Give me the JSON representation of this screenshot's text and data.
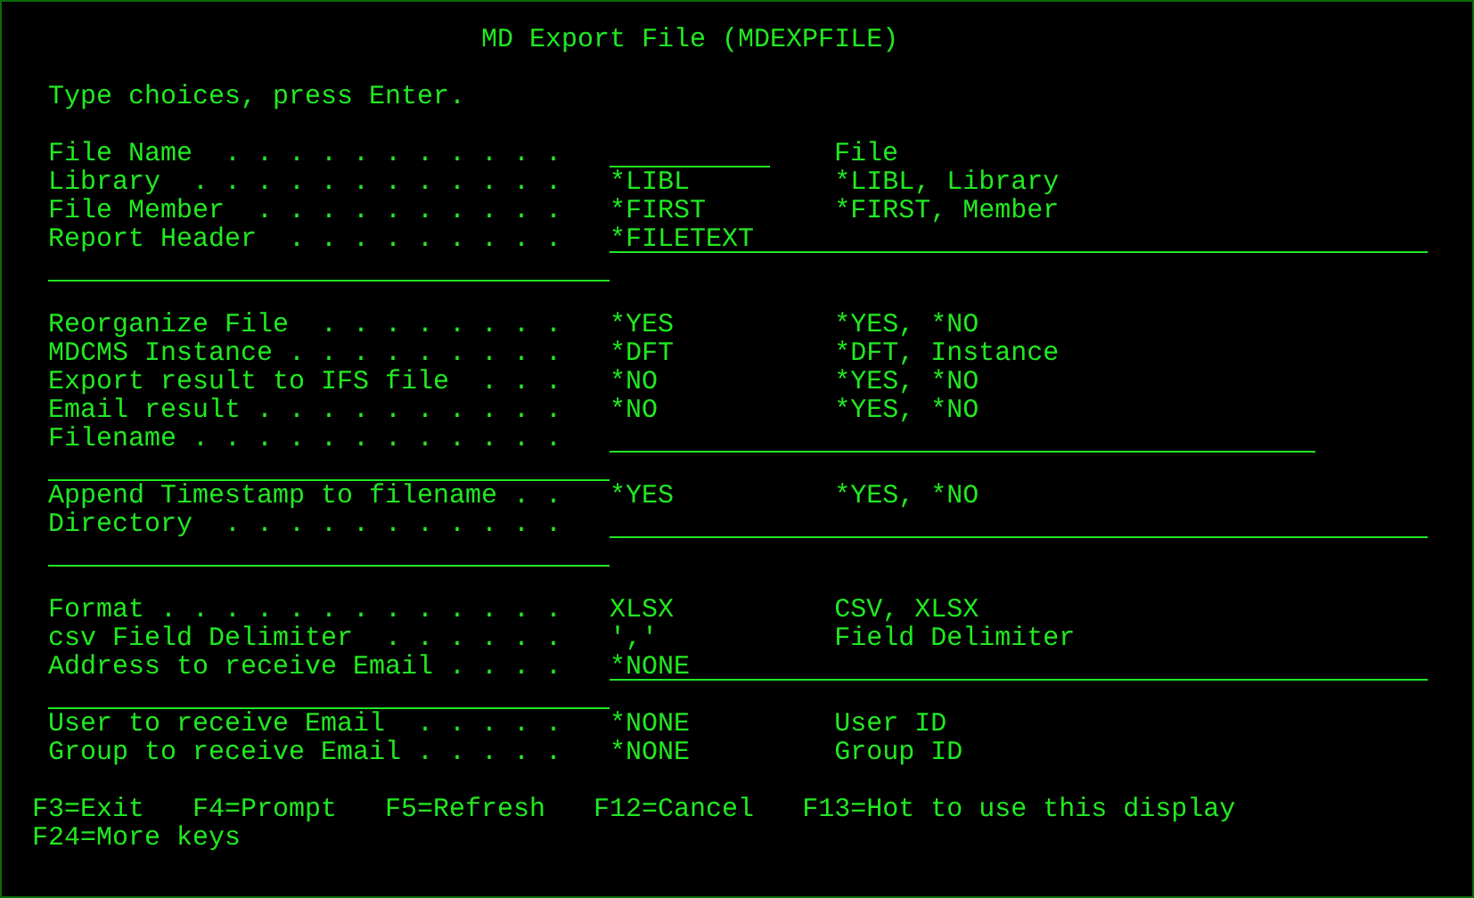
{
  "title": "MD Export File (MDEXPFILE)",
  "instruction": "Type choices, press Enter.",
  "sections": [
    {
      "rows": [
        {
          "label": "File Name  . . . . . . . . . . .",
          "kind": "name",
          "hint": "File",
          "wraps": false
        },
        {
          "label": "Library  . . . . . . . . . . . .",
          "kind": "choice",
          "value": "*LIBL",
          "hint": "*LIBL, Library",
          "wraps": false
        },
        {
          "label": "File Member  . . . . . . . . . .",
          "kind": "choice",
          "value": "*FIRST",
          "hint": "*FIRST, Member",
          "wraps": false
        },
        {
          "label": "Report Header  . . . . . . . . .",
          "kind": "long",
          "value": "*FILETEXT",
          "wraps": true
        }
      ]
    },
    {
      "rows": [
        {
          "label": "Reorganize File  . . . . . . . .",
          "kind": "choice",
          "value": "*YES",
          "hint": "*YES, *NO",
          "wraps": false
        },
        {
          "label": "MDCMS Instance . . . . . . . . .",
          "kind": "choice",
          "value": "*DFT",
          "hint": "*DFT, Instance",
          "wraps": false
        },
        {
          "label": "Export result to IFS file  . . .",
          "kind": "choice",
          "value": "*NO",
          "hint": "*YES, *NO",
          "wraps": false
        },
        {
          "label": "Email result . . . . . . . . . .",
          "kind": "choice",
          "value": "*NO",
          "hint": "*YES, *NO",
          "wraps": false
        },
        {
          "label": "Filename . . . . . . . . . . . .",
          "kind": "path",
          "wraps": true
        },
        {
          "label": "Append Timestamp to filename . .",
          "kind": "choice",
          "value": "*YES",
          "hint": "*YES, *NO",
          "wraps": false
        },
        {
          "label": "Directory  . . . . . . . . . . .",
          "kind": "long",
          "wraps": true
        }
      ]
    },
    {
      "rows": [
        {
          "label": "Format . . . . . . . . . . . . .",
          "kind": "choice",
          "value": "XLSX",
          "hint": "CSV, XLSX",
          "wraps": false
        },
        {
          "label": "csv Field Delimiter  . . . . . .",
          "kind": "choice",
          "value": "','",
          "hint": "Field Delimiter",
          "wraps": false
        },
        {
          "label": "Address to receive Email . . . .",
          "kind": "long",
          "value": "*NONE",
          "wraps": true
        },
        {
          "label": "User to receive Email  . . . . .",
          "kind": "choice",
          "value": "*NONE",
          "hint": "User ID",
          "wraps": false
        },
        {
          "label": "Group to receive Email . . . . .",
          "kind": "choice",
          "value": "*NONE",
          "hint": "Group ID",
          "wraps": false
        }
      ]
    }
  ],
  "function_keys": [
    [
      "F3=Exit",
      "F4=Prompt",
      "F5=Refresh",
      "F12=Cancel",
      "F13=Hot to use this display"
    ],
    [
      "F24=More keys"
    ]
  ]
}
